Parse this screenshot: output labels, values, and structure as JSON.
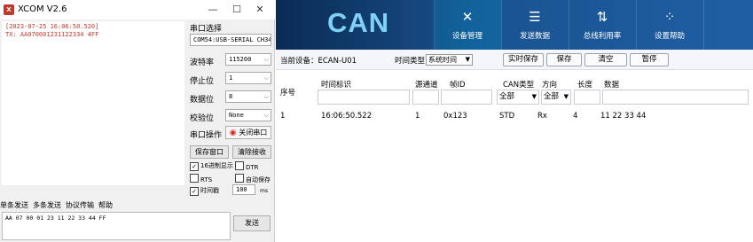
{
  "xcom": {
    "title": "XCOM V2.6",
    "window_buttons": [
      "—",
      "☐",
      "✕"
    ],
    "log_lines": [
      "[2023-07-25 16:06:50.520]",
      "TX: AA070001231122334 4FF"
    ],
    "labels": {
      "port_select": "串口选择",
      "baud": "波特率",
      "stop_bits": "停止位",
      "data_bits": "数据位",
      "parity": "校验位",
      "port_op": "串口操作"
    },
    "port_value": "COM54:USB-SERIAL CH34",
    "baud_value": "115200",
    "stop_value": "1",
    "data_value": "8",
    "parity_value": "None",
    "close_port_label": "关闭串口",
    "save_window_label": "保存窗口",
    "clear_receive_label": "清除接收",
    "hex_display_label": "16进制显示",
    "dtr_label": "DTR",
    "rts_label": "RTS",
    "auto_save_label": "自动保存",
    "timestamp_label": "时间戳",
    "timestamp_value": "100",
    "ms_label": "ms",
    "tabs": [
      "单条发送",
      "多条发送",
      "协议传输",
      "帮助"
    ],
    "send_text": "AA 07 00  01 23 11 22 33 44 FF",
    "send_label": "发送"
  },
  "can": {
    "logo": "CAN",
    "nav": [
      {
        "label": "设备管理",
        "icon": "tools-icon",
        "glyph": "✕"
      },
      {
        "label": "发送数据",
        "icon": "sliders-icon",
        "glyph": "☰"
      },
      {
        "label": "总线利用率",
        "icon": "bus-load-icon",
        "glyph": "⇅"
      },
      {
        "label": "设置帮助",
        "icon": "settings-grid-icon",
        "glyph": "⁘"
      }
    ],
    "toolbar": {
      "device_label": "当前设备：ECAN-U01",
      "time_type_label": "时间类型",
      "time_type_value": "系统时间",
      "realtime_save": "实时保存",
      "save": "保存",
      "clear": "清空",
      "pause": "暂停"
    },
    "columns": {
      "index": "序号",
      "timestamp": "时间标识",
      "channel": "源通道",
      "frame_id": "帧ID",
      "can_type": "CAN类型",
      "direction": "方向",
      "length": "长度",
      "data": "数据"
    },
    "filter_all_type": "全部",
    "filter_all_dir": "全部",
    "rows": [
      {
        "index": "1",
        "time": "16:06:50.522",
        "channel": "1",
        "id": "0x123",
        "type": "STD",
        "dir": "Rx",
        "len": "4",
        "data": "11 22 33 44"
      }
    ],
    "colors": {
      "header_dark": "#0a2c55",
      "header_light": "#1e5fa3",
      "logo": "#7fd1f6"
    }
  }
}
